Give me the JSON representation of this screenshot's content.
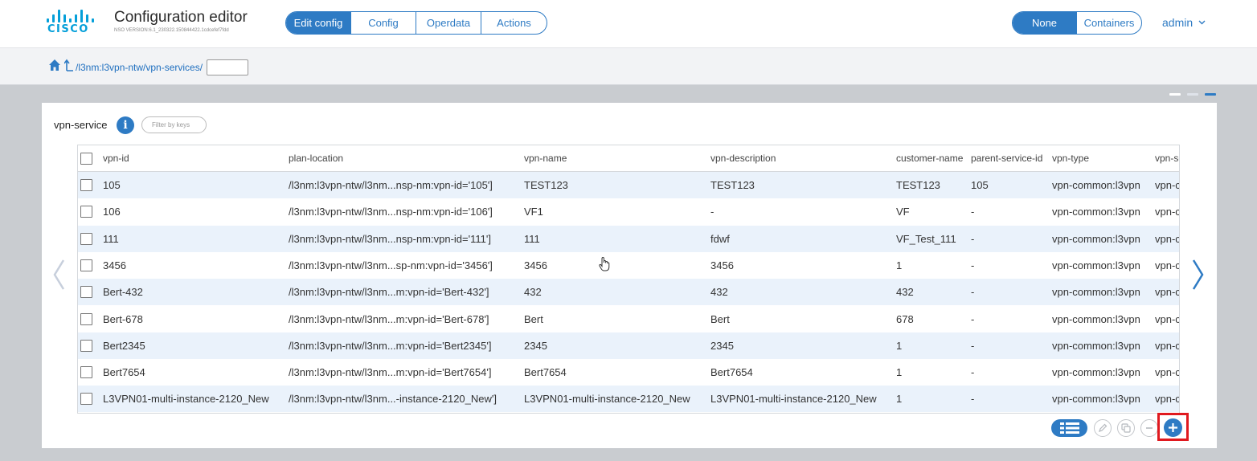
{
  "header": {
    "logo_text": "CISCO",
    "title": "Configuration editor",
    "version": "NSO VERSION:6.1_230322.150844422.1cdcefef7fdd",
    "tabs": [
      "Edit config",
      "Config",
      "Operdata",
      "Actions"
    ],
    "active_tab": "Edit config",
    "view_modes": [
      "None",
      "Containers"
    ],
    "active_view_mode": "None",
    "user": "admin",
    "accent_color": "#2e7bc4"
  },
  "breadcrumb": {
    "path": "/l3nm:l3vpn-ntw/vpn-services/",
    "input_value": ""
  },
  "list": {
    "title": "vpn-service",
    "filter_placeholder": "Filter by keys",
    "columns": [
      "vpn-id",
      "plan-location",
      "vpn-name",
      "vpn-description",
      "customer-name",
      "parent-service-id",
      "vpn-type",
      "vpn-se"
    ],
    "rows": [
      [
        "105",
        "/l3nm:l3vpn-ntw/l3nm...nsp-nm:vpn-id='105']",
        "TEST123",
        "TEST123",
        "TEST123",
        "105",
        "vpn-common:l3vpn",
        "vpn-c"
      ],
      [
        "106",
        "/l3nm:l3vpn-ntw/l3nm...nsp-nm:vpn-id='106']",
        "VF1",
        "-",
        "VF",
        "-",
        "vpn-common:l3vpn",
        "vpn-c"
      ],
      [
        "111",
        "/l3nm:l3vpn-ntw/l3nm...nsp-nm:vpn-id='111']",
        "111",
        "fdwf",
        "VF_Test_111",
        "-",
        "vpn-common:l3vpn",
        "vpn-c"
      ],
      [
        "3456",
        "/l3nm:l3vpn-ntw/l3nm...sp-nm:vpn-id='3456']",
        "3456",
        "3456",
        "1",
        "-",
        "vpn-common:l3vpn",
        "vpn-c"
      ],
      [
        "Bert-432",
        "/l3nm:l3vpn-ntw/l3nm...m:vpn-id='Bert-432']",
        "432",
        "432",
        "432",
        "-",
        "vpn-common:l3vpn",
        "vpn-c"
      ],
      [
        "Bert-678",
        "/l3nm:l3vpn-ntw/l3nm...m:vpn-id='Bert-678']",
        "Bert",
        "Bert",
        "678",
        "-",
        "vpn-common:l3vpn",
        "vpn-c"
      ],
      [
        "Bert2345",
        "/l3nm:l3vpn-ntw/l3nm...m:vpn-id='Bert2345']",
        "2345",
        "2345",
        "1",
        "-",
        "vpn-common:l3vpn",
        "vpn-c"
      ],
      [
        "Bert7654",
        "/l3nm:l3vpn-ntw/l3nm...m:vpn-id='Bert7654']",
        "Bert7654",
        "Bert7654",
        "1",
        "-",
        "vpn-common:l3vpn",
        "vpn-c"
      ],
      [
        "L3VPN01-multi-instance-2120_New",
        "/l3nm:l3vpn-ntw/l3nm...-instance-2120_New']",
        "L3VPN01-multi-instance-2120_New",
        "L3VPN01-multi-instance-2120_New",
        "1",
        "-",
        "vpn-common:l3vpn",
        "vpn-c"
      ]
    ]
  },
  "toolbar": {
    "icons": [
      "list-view-icon",
      "edit-icon",
      "copy-icon",
      "remove-icon",
      "add-icon"
    ],
    "highlight_color": "#e0191f"
  }
}
